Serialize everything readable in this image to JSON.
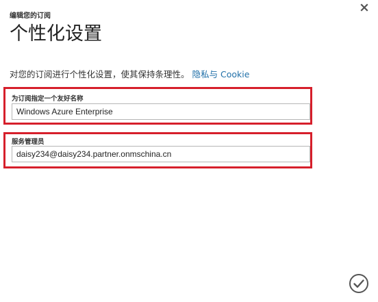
{
  "header": {
    "breadcrumb": "编辑您的订阅",
    "title": "个性化设置"
  },
  "icons": {
    "close": "close-icon",
    "confirm": "checkmark-circle-icon"
  },
  "description": {
    "text": "对您的订阅进行个性化设置，使其保持条理性。",
    "link": "隐私与 Cookie"
  },
  "fields": {
    "friendly_name": {
      "label": "为订阅指定一个友好名称",
      "value": "Windows Azure Enterprise"
    },
    "service_admin": {
      "label": "服务管理员",
      "value": "daisy234@daisy234.partner.onmschina.cn"
    }
  },
  "colors": {
    "highlight_border": "#d61f2b",
    "link": "#1f6fa8"
  }
}
